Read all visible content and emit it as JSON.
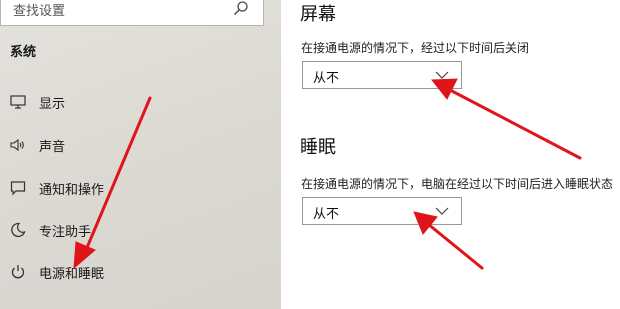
{
  "sidebar": {
    "search_placeholder": "查找设置",
    "section_title": "系统",
    "items": [
      {
        "label": "显示",
        "icon": "monitor-icon"
      },
      {
        "label": "声音",
        "icon": "speaker-icon"
      },
      {
        "label": "通知和操作",
        "icon": "message-icon"
      },
      {
        "label": "专注助手",
        "icon": "moon-icon"
      },
      {
        "label": "电源和睡眠",
        "icon": "power-icon"
      }
    ]
  },
  "screen": {
    "title": "屏幕",
    "description": "在接通电源的情况下，经过以下时间后关闭",
    "value": "从不"
  },
  "sleep": {
    "title": "睡眠",
    "description": "在接通电源的情况下，电脑在经过以下时间后进入睡眠状态",
    "value": "从不"
  },
  "colors": {
    "annotation_arrow": "#e0141b"
  }
}
